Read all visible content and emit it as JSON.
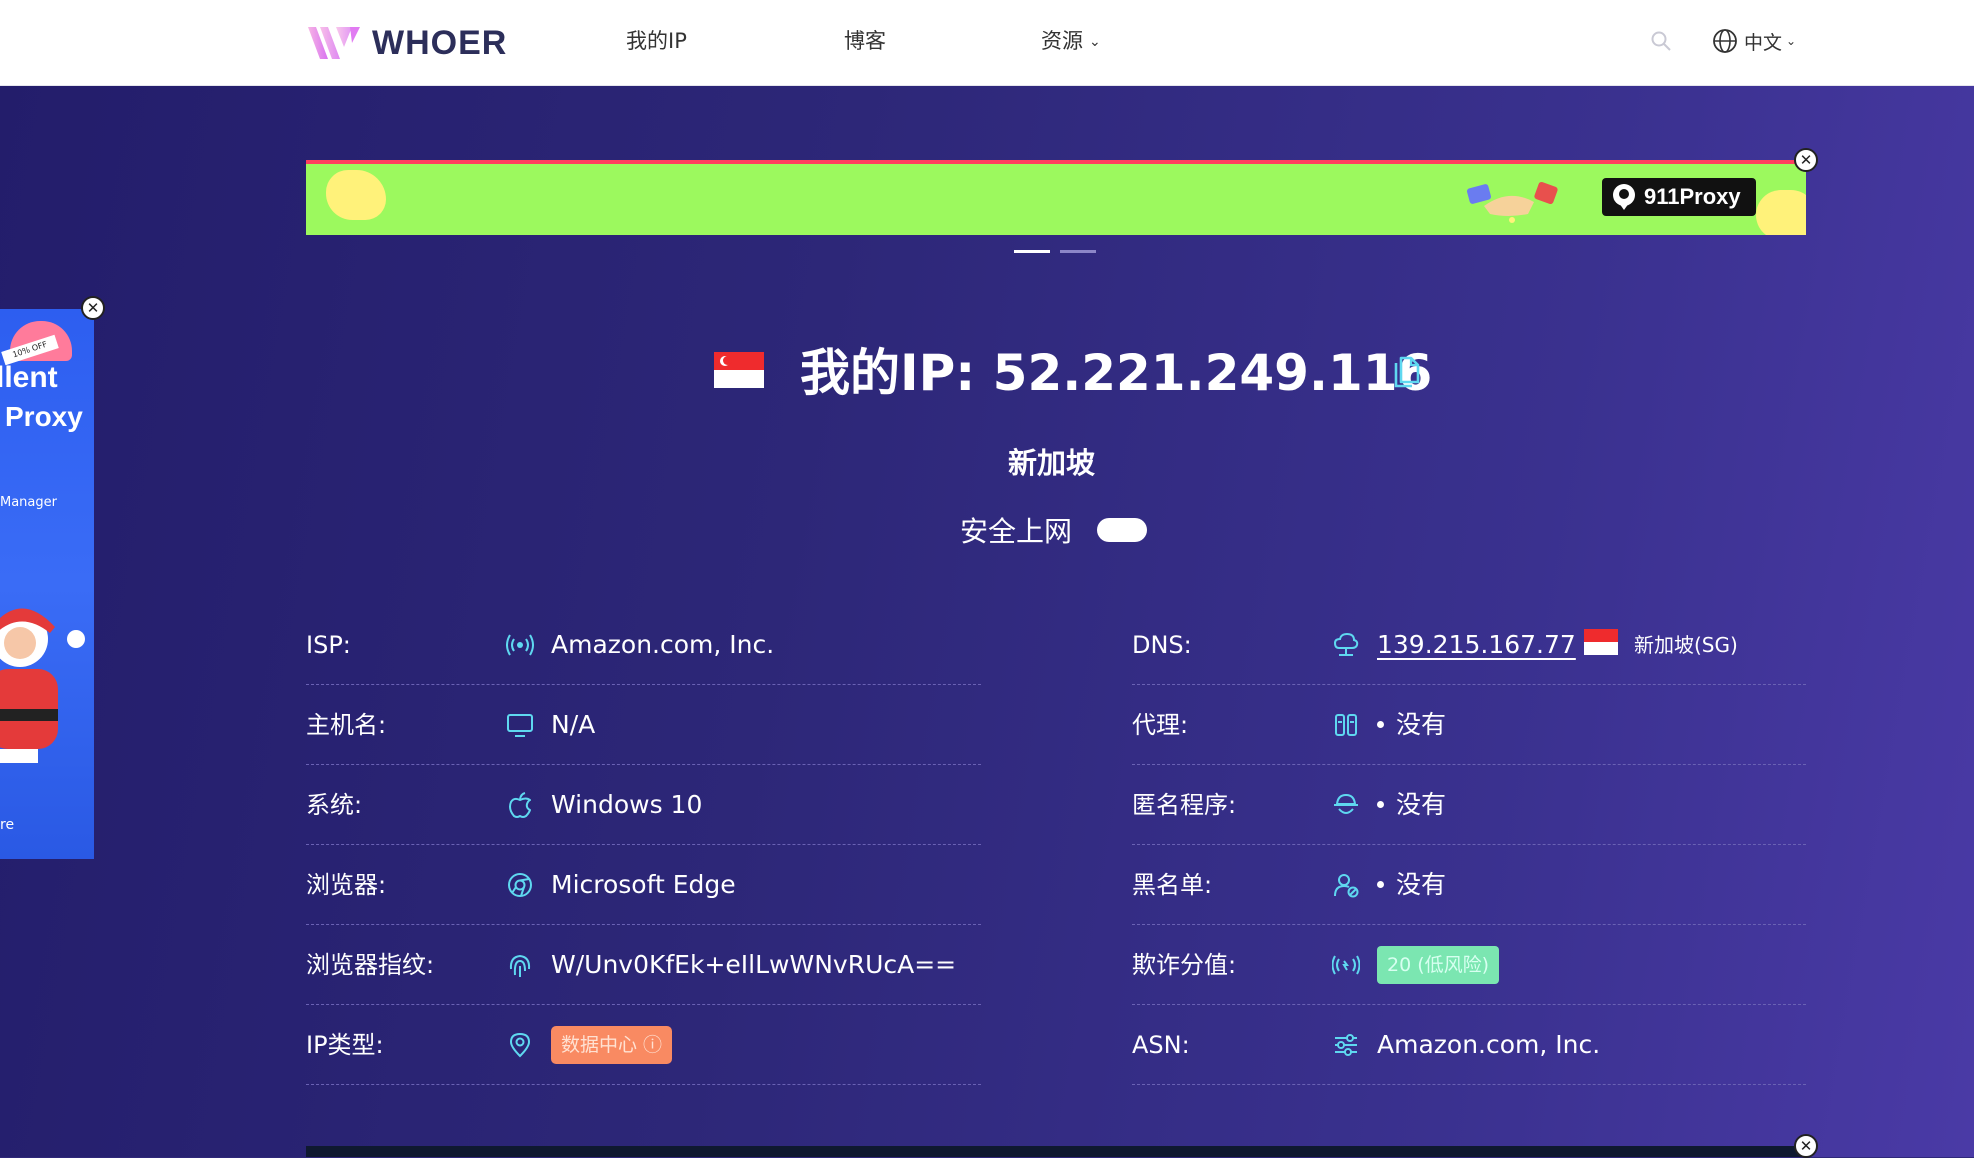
{
  "header": {
    "brand": "WHOER",
    "nav": {
      "my_ip": "我的IP",
      "blog": "博客",
      "resources": "资源"
    },
    "language": "中文"
  },
  "ads": {
    "top_banner_brand": "911Proxy",
    "side_tag": "10% OFF",
    "side_line1": "llent",
    "side_line2": "Proxy",
    "side_line3": "Manager",
    "side_line4": "re"
  },
  "ip_info": {
    "title": "我的IP:  52.221.249.116",
    "country": "新加坡",
    "safe_browsing_label": "安全上网",
    "safe_browsing_on": false
  },
  "details_left": [
    {
      "label": "ISP:",
      "icon": "signal-icon",
      "value": "Amazon.com, Inc."
    },
    {
      "label": "主机名:",
      "icon": "monitor-icon",
      "value": "N/A"
    },
    {
      "label": "系统:",
      "icon": "apple-icon",
      "value": "Windows 10"
    },
    {
      "label": "浏览器:",
      "icon": "chrome-icon",
      "value": "Microsoft Edge"
    },
    {
      "label": "浏览器指纹:",
      "icon": "fingerprint-icon",
      "value": "W/Unv0KfEk+eIlLwWNvRUcA=="
    },
    {
      "label": "IP类型:",
      "icon": "location-pin-icon",
      "value": "数据中心 ⓘ"
    }
  ],
  "details_right": [
    {
      "label": "DNS:",
      "icon": "dns-cloud-icon",
      "value": "139.215.167.77",
      "country": "新加坡(SG)"
    },
    {
      "label": "代理:",
      "icon": "proxy-icon",
      "value": "没有"
    },
    {
      "label": "匿名程序:",
      "icon": "incognito-icon",
      "value": "没有"
    },
    {
      "label": "黑名单:",
      "icon": "user-block-icon",
      "value": "没有"
    },
    {
      "label": "欺诈分值:",
      "icon": "broadcast-icon",
      "value": "20 (低风险)"
    },
    {
      "label": "ASN:",
      "icon": "sliders-icon",
      "value": "Amazon.com, Inc."
    }
  ],
  "colors": {
    "header_bg": "#ffffff",
    "page_bg": "#2d2778",
    "accent_icon": "#5fd8f0",
    "badge_datacenter": "#f98a62",
    "badge_score": "#7be6b1",
    "banner_bg": "#9cf95e"
  }
}
